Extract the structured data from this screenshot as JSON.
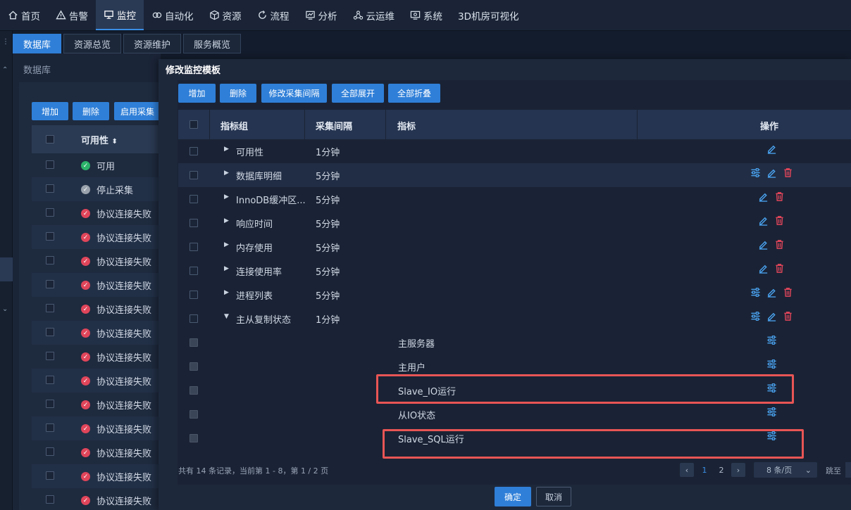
{
  "nav": {
    "items": [
      {
        "label": "首页",
        "icon": "home-icon"
      },
      {
        "label": "告警",
        "icon": "warning-icon"
      },
      {
        "label": "监控",
        "icon": "monitor-icon",
        "active": true
      },
      {
        "label": "自动化",
        "icon": "automation-icon"
      },
      {
        "label": "资源",
        "icon": "resource-icon"
      },
      {
        "label": "流程",
        "icon": "flow-icon"
      },
      {
        "label": "分析",
        "icon": "chart-icon"
      },
      {
        "label": "云运维",
        "icon": "cloud-icon"
      },
      {
        "label": "系统",
        "icon": "system-icon"
      },
      {
        "label": "3D机房可视化",
        "icon": ""
      }
    ]
  },
  "tabs": [
    {
      "label": "数据库",
      "active": true
    },
    {
      "label": "资源总览"
    },
    {
      "label": "资源维护"
    },
    {
      "label": "服务概览"
    }
  ],
  "background": {
    "breadcrumb": "数据库",
    "buttons": {
      "add": "增加",
      "delete": "删除",
      "enable": "启用采集"
    },
    "column": "可用性",
    "rows": [
      {
        "status": "可用",
        "type": "ok"
      },
      {
        "status": "停止采集",
        "type": "stopped"
      },
      {
        "status": "协议连接失败",
        "type": "fail"
      },
      {
        "status": "协议连接失败",
        "type": "fail"
      },
      {
        "status": "协议连接失败",
        "type": "fail"
      },
      {
        "status": "协议连接失败",
        "type": "fail"
      },
      {
        "status": "协议连接失败",
        "type": "fail"
      },
      {
        "status": "协议连接失败",
        "type": "fail"
      },
      {
        "status": "协议连接失败",
        "type": "fail"
      },
      {
        "status": "协议连接失败",
        "type": "fail"
      },
      {
        "status": "协议连接失败",
        "type": "fail"
      },
      {
        "status": "协议连接失败",
        "type": "fail"
      },
      {
        "status": "协议连接失败",
        "type": "fail"
      },
      {
        "status": "协议连接失败",
        "type": "fail"
      },
      {
        "status": "协议连接失败",
        "type": "fail"
      }
    ]
  },
  "modal": {
    "title": "修改监控模板",
    "toolbar": {
      "add": "增加",
      "delete": "删除",
      "edit_interval": "修改采集间隔",
      "expand_all": "全部展开",
      "collapse_all": "全部折叠"
    },
    "columns": {
      "group": "指标组",
      "interval": "采集间隔",
      "metric": "指标",
      "ops": "操作"
    },
    "rows": [
      {
        "group": "可用性",
        "interval": "1分钟",
        "ops": [
          "edit"
        ]
      },
      {
        "group": "数据库明细",
        "interval": "5分钟",
        "ops": [
          "settings",
          "edit",
          "delete"
        ]
      },
      {
        "group": "InnoDB缓冲区...",
        "interval": "5分钟",
        "ops": [
          "edit",
          "delete"
        ]
      },
      {
        "group": "响应时间",
        "interval": "5分钟",
        "ops": [
          "edit",
          "delete"
        ]
      },
      {
        "group": "内存使用",
        "interval": "5分钟",
        "ops": [
          "edit",
          "delete"
        ]
      },
      {
        "group": "连接使用率",
        "interval": "5分钟",
        "ops": [
          "edit",
          "delete"
        ]
      },
      {
        "group": "进程列表",
        "interval": "5分钟",
        "ops": [
          "settings",
          "edit",
          "delete"
        ]
      },
      {
        "group": "主从复制状态",
        "interval": "1分钟",
        "ops": [
          "settings",
          "edit",
          "delete"
        ],
        "expanded": true
      }
    ],
    "subrows": [
      {
        "metric": "主服务器"
      },
      {
        "metric": "主用户"
      },
      {
        "metric": "Slave_IO运行"
      },
      {
        "metric": "从IO状态"
      },
      {
        "metric": "Slave_SQL运行"
      }
    ],
    "pager": {
      "info": "共有 14 条记录，当前第 1 - 8，第 1 / 2 页",
      "page1": "1",
      "page2": "2",
      "page_size": "8 条/页",
      "jump": "跳至"
    },
    "footer": {
      "ok": "确定",
      "cancel": "取消"
    }
  },
  "colors": {
    "accent": "#2f7fd8",
    "danger": "#e0455a",
    "ok": "#2bb36a",
    "highlight": "#e85555"
  }
}
